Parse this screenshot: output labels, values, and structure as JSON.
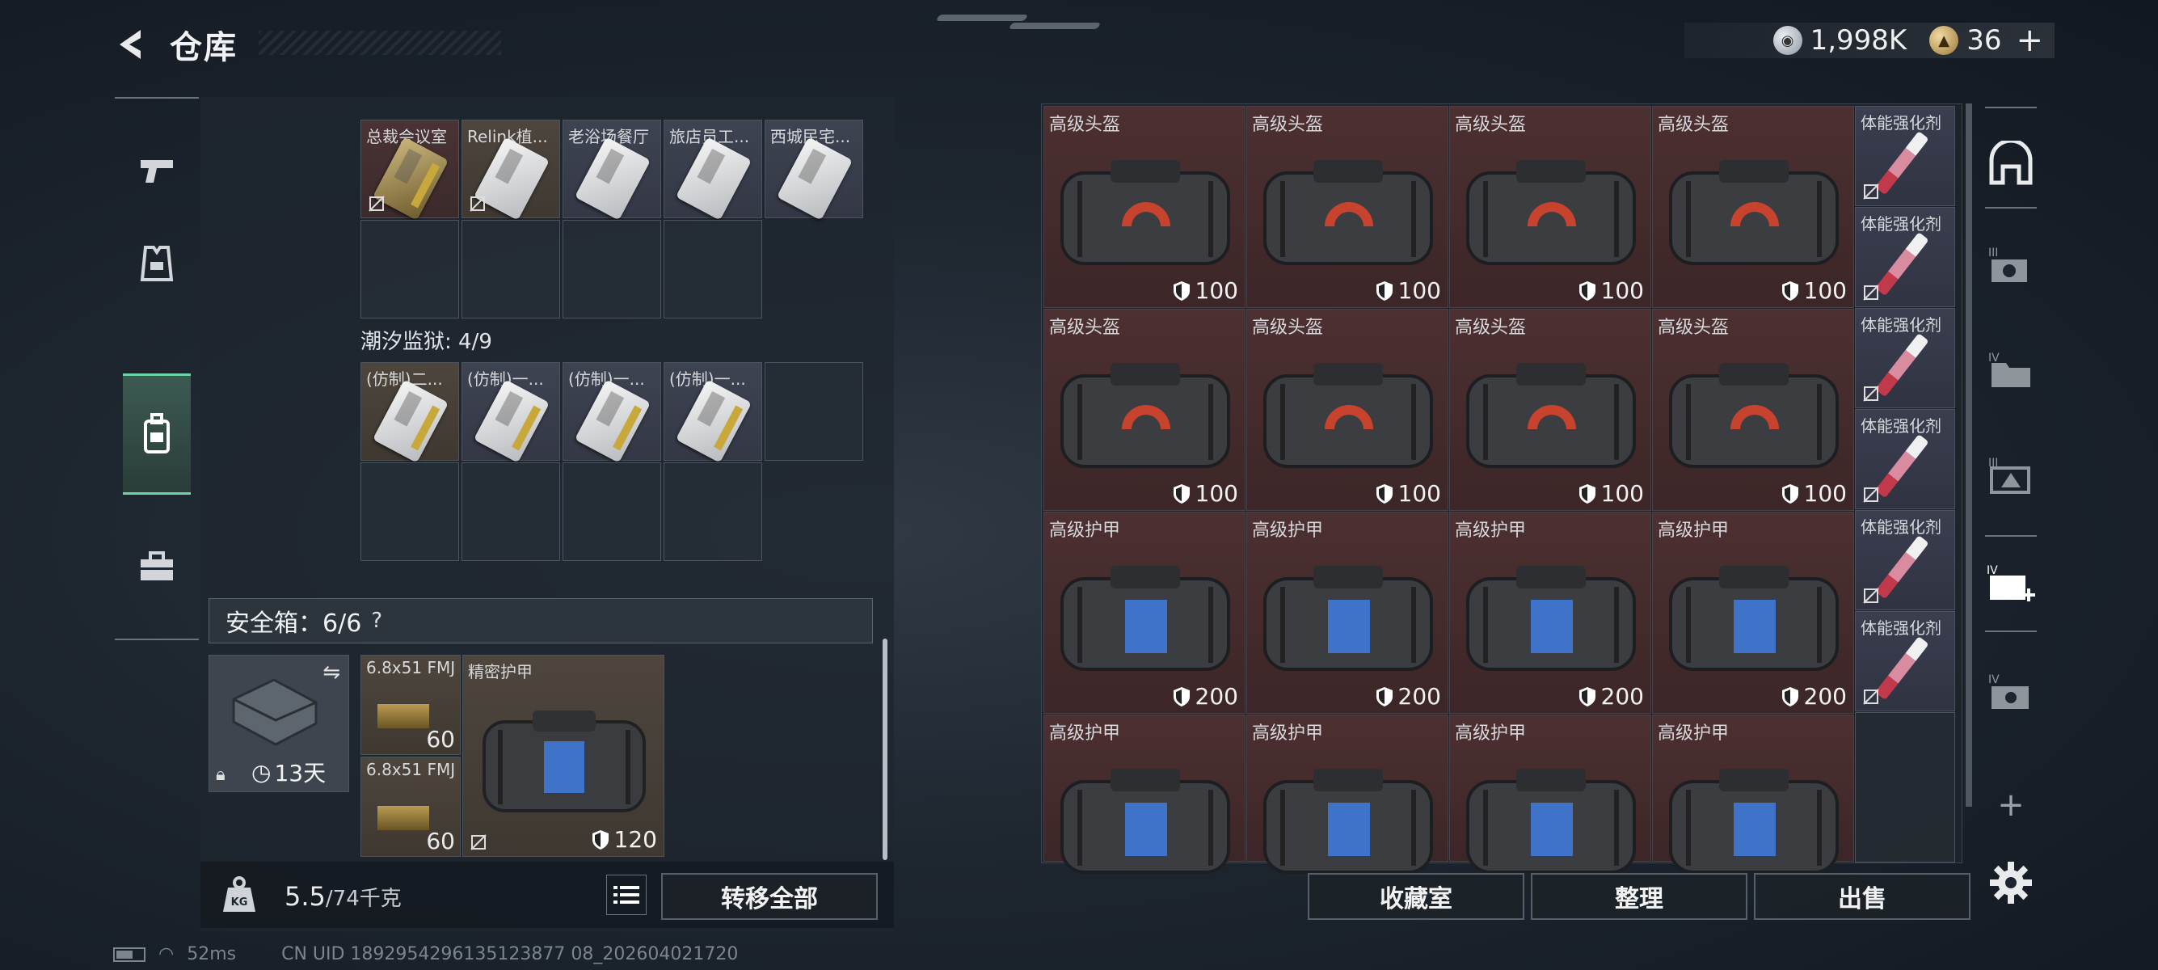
{
  "header": {
    "title": "仓库"
  },
  "currency": [
    {
      "icon": "silver-coin-icon",
      "value": "1,998K"
    },
    {
      "icon": "gold-coin-icon",
      "value": "36"
    }
  ],
  "left_nav": [
    {
      "name": "weapons",
      "icon": "pistol-icon"
    },
    {
      "name": "equipment",
      "icon": "vest-icon"
    },
    {
      "name": "backpack",
      "icon": "backpack-icon",
      "active": true
    },
    {
      "name": "supplies",
      "icon": "toolbox-icon"
    }
  ],
  "cards_section_top": {
    "cards": [
      {
        "label": "总裁会议室",
        "style": "gold"
      },
      {
        "label": "Relink植...",
        "style": "silver"
      },
      {
        "label": "老浴场餐厅",
        "style": "silver"
      },
      {
        "label": "旅店员工...",
        "style": "silver"
      },
      {
        "label": "西城民宅...",
        "style": "silver"
      }
    ]
  },
  "cards_section_2": {
    "title": "潮汐监狱: 4/9",
    "cards": [
      {
        "label": "(仿制)二..."
      },
      {
        "label": "(仿制)一..."
      },
      {
        "label": "(仿制)一..."
      },
      {
        "label": "(仿制)一..."
      }
    ]
  },
  "safe_box": {
    "title": "安全箱：6/6",
    "help": "?",
    "duration": "13天",
    "items": [
      {
        "label": "6.8x51 FMJ",
        "count": "60"
      },
      {
        "label": "6.8x51 FMJ",
        "count": "60"
      }
    ],
    "armor": {
      "label": "精密护甲",
      "durability": "120"
    }
  },
  "bottom_bar": {
    "weight_icon_text": "KG",
    "weight_current": "5.5",
    "weight_max": "/74千克",
    "transfer_all": "转移全部"
  },
  "stash": {
    "rows": [
      {
        "label": "高级头盔",
        "durability": "100",
        "kind": "helmet"
      },
      {
        "label": "高级头盔",
        "durability": "100",
        "kind": "helmet"
      },
      {
        "label": "高级护甲",
        "durability": "200",
        "kind": "armor"
      },
      {
        "label": "高级护甲",
        "durability": "",
        "kind": "armor"
      }
    ],
    "side_items": [
      "体能强化剂",
      "体能强化剂",
      "体能强化剂",
      "体能强化剂",
      "体能强化剂",
      "体能强化剂"
    ]
  },
  "actions": {
    "collection": "收藏室",
    "organize": "整理",
    "sell": "出售"
  },
  "right_nav": {
    "tiers": [
      "",
      "III",
      "IV",
      "III",
      "IV",
      "IV"
    ],
    "add": "+"
  },
  "status": {
    "ping": "52ms",
    "uid": "CN UID 1892954296135123877 08_202604021720"
  },
  "colors": {
    "accent_green": "#6fd3a8",
    "cell_red": "#4d3031",
    "cell_blue": "#3b3e4f"
  }
}
